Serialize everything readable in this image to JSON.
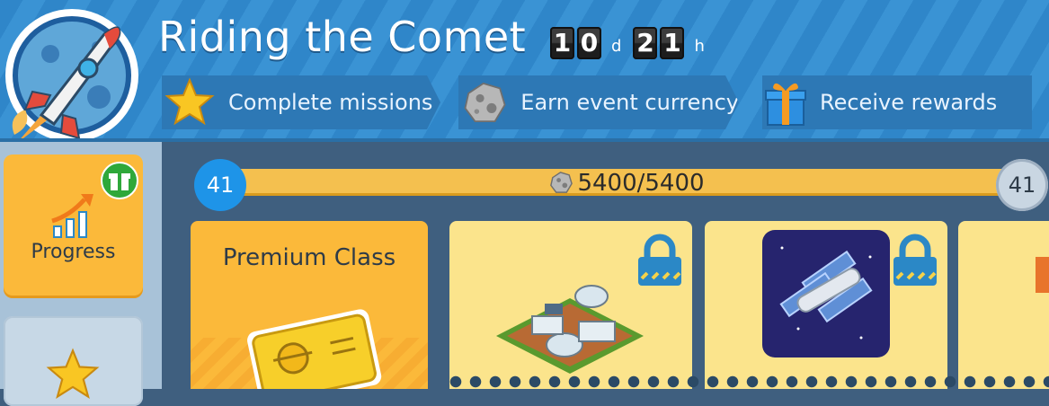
{
  "event": {
    "title": "Riding the Comet",
    "timer": {
      "days_digits": [
        "1",
        "0"
      ],
      "days_unit": "d",
      "hours_digits": [
        "2",
        "1"
      ],
      "hours_unit": "h"
    }
  },
  "steps": [
    {
      "label": "Complete missions",
      "icon": "star-icon"
    },
    {
      "label": "Earn event currency",
      "icon": "meteor-rock-icon"
    },
    {
      "label": "Receive rewards",
      "icon": "gift-box-icon"
    }
  ],
  "sidebar": {
    "tabs": [
      {
        "label": "Progress",
        "icon": "progress-chart-icon",
        "badge_icon": "gift-badge-icon",
        "selected": true
      },
      {
        "label": "",
        "icon": "star-icon",
        "selected": false
      }
    ]
  },
  "progress": {
    "current_level": "41",
    "next_level": "41",
    "currency_text": "5400/5400",
    "currency_icon": "meteor-rock-icon",
    "fraction": 1.0
  },
  "cards": [
    {
      "title": "Premium Class",
      "image": "premium-ticket-icon"
    },
    {
      "image": "lunar-base-building-icon",
      "locked": true
    },
    {
      "image": "space-station-icon",
      "locked": true
    },
    {
      "image": "reward-item-partial",
      "locked": false
    }
  ],
  "colors": {
    "header_blue": "#3a93d4",
    "accent_orange": "#fbb93a",
    "card_yellow": "#fbe48c",
    "level_blue": "#1e94e8",
    "lock_blue": "#2b88c6"
  }
}
